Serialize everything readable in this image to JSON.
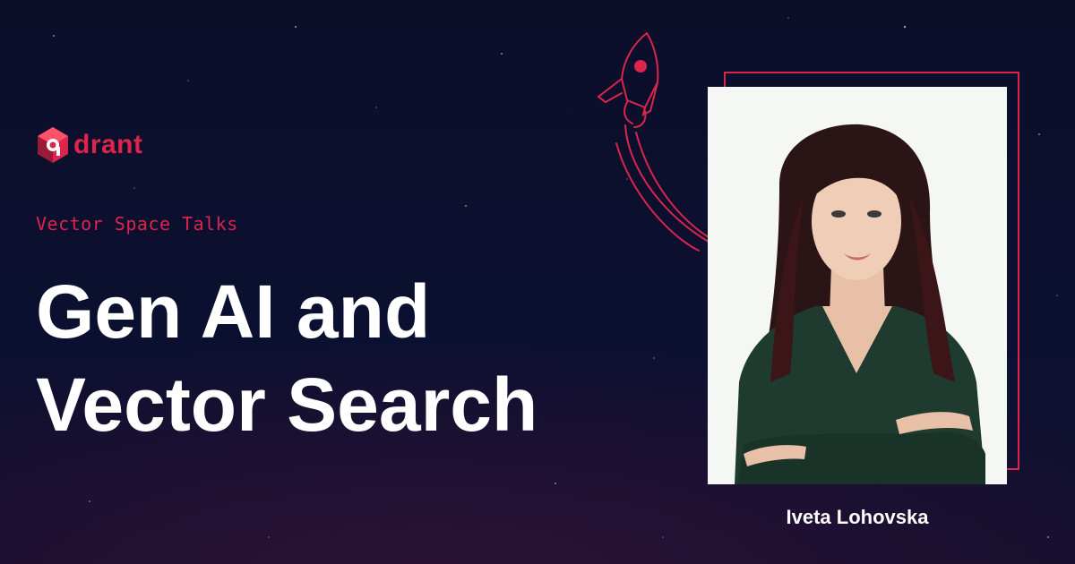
{
  "brand": {
    "logo_text": "drant",
    "accent_color": "#dc244c",
    "background_color": "#0b0f2a"
  },
  "eyebrow": "Vector Space Talks",
  "title": {
    "line1": "Gen AI and",
    "line2": "Vector Search"
  },
  "speaker": {
    "name": "Iveta Lohovska"
  },
  "icons": {
    "logo": "qdrant-logo-icon",
    "rocket": "rocket-icon"
  }
}
